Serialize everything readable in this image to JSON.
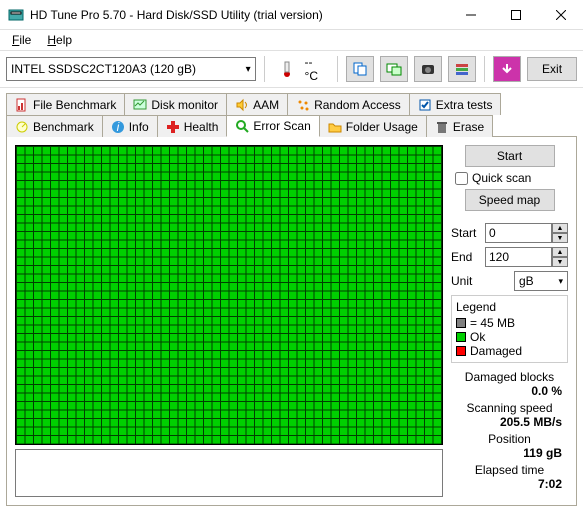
{
  "title": "HD Tune Pro 5.70 - Hard Disk/SSD Utility (trial version)",
  "menu": {
    "file": "File",
    "help": "Help"
  },
  "drive": "INTEL SSDSC2CT120A3 (120 gB)",
  "temp": "-- °C",
  "exit": "Exit",
  "tabs_row1": [
    {
      "label": "File Benchmark"
    },
    {
      "label": "Disk monitor"
    },
    {
      "label": "AAM"
    },
    {
      "label": "Random Access"
    },
    {
      "label": "Extra tests"
    }
  ],
  "tabs_row2": [
    {
      "label": "Benchmark"
    },
    {
      "label": "Info"
    },
    {
      "label": "Health"
    },
    {
      "label": "Error Scan",
      "active": true
    },
    {
      "label": "Folder Usage"
    },
    {
      "label": "Erase"
    }
  ],
  "right": {
    "start_btn": "Start",
    "quick_scan": "Quick scan",
    "speed_map": "Speed map",
    "start_lbl": "Start",
    "start_val": "0",
    "end_lbl": "End",
    "end_val": "120",
    "unit_lbl": "Unit",
    "unit_val": "gB",
    "legend": {
      "title": "Legend",
      "block": "= 45 MB",
      "ok": "Ok",
      "damaged": "Damaged"
    },
    "stats": {
      "damaged_lbl": "Damaged blocks",
      "damaged_val": "0.0 %",
      "speed_lbl": "Scanning speed",
      "speed_val": "205.5 MB/s",
      "pos_lbl": "Position",
      "pos_val": "119 gB",
      "time_lbl": "Elapsed time",
      "time_val": "7:02"
    }
  }
}
